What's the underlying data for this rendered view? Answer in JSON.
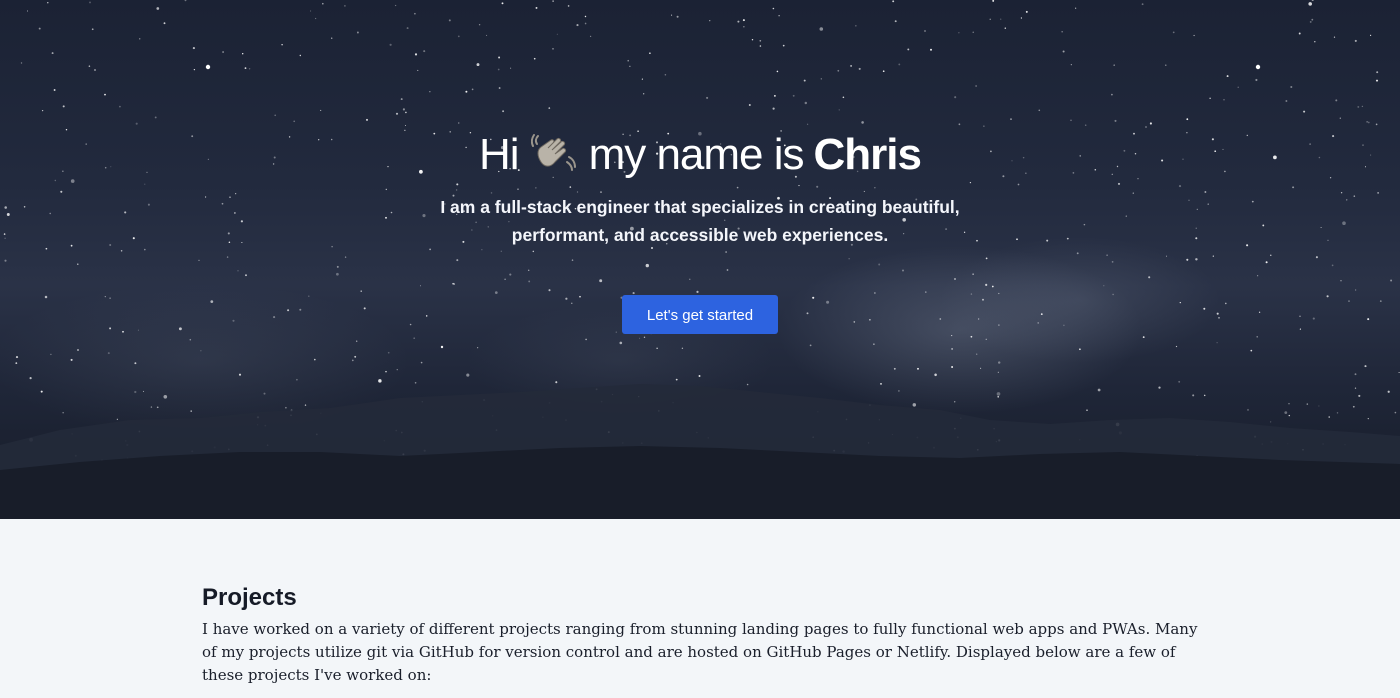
{
  "hero": {
    "greeting": "Hi",
    "wave_icon": "waving-hand-icon",
    "middle": "my name is",
    "name": "Chris",
    "subtitle": "I am a full-stack engineer that specializes in creating beautiful, performant, and accessible web experiences.",
    "cta_label": "Let's get started"
  },
  "projects": {
    "title": "Projects",
    "description": "I have worked on a variety of different projects ranging from stunning landing pages to fully functional web apps and PWAs. Many of my projects utilize git via GitHub for version control and are hosted on GitHub Pages or Netlify. Displayed below are a few of these projects I've worked on:"
  },
  "colors": {
    "accent": "#2d63e0",
    "hero_bg": "#1b2234",
    "page_bg": "#f3f6f9",
    "text_dark": "#161b27"
  }
}
